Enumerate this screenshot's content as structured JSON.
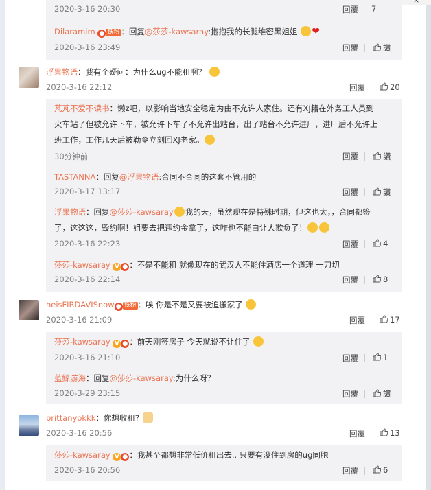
{
  "actions": {
    "reply": "回覆",
    "like_zero": "讚"
  },
  "c0": {
    "time": "2020-3-16 20:30"
  },
  "c1": {
    "name": "Dilaramim",
    "badge": "铁粉",
    "prefix": "：回复",
    "at": "@莎莎-kawsaray",
    "text": ":抱抱我的长腿维密黑姐姐",
    "time": "2020-3-16 23:49"
  },
  "c2": {
    "name": "浮果物语",
    "text": "：我有个疑问：为什么ug不能租啊？",
    "time": "2020-3-16 22:12",
    "likes": "20"
  },
  "c2r1": {
    "name": "芃芃不爱不读书",
    "line1": "：懒z吧，以影响当地安全稳定为由不允许人家住。还有XJ籍在外务工人员到",
    "line2": "火车站了但被允许下车，被允许下车了不允许出站台，出了站台不允许进厂，进厂后不允许上",
    "line3": "班工作，工作几天后被勒令立刻回XJ老家。",
    "time": "30分钟前"
  },
  "c2r2": {
    "name": "TASTANNA",
    "prefix": "：回复",
    "at": "@浮果物语",
    "text": ":合同不合同的这套不管用的",
    "time": "2020-3-17 13:17"
  },
  "c2r3": {
    "name": "浮果物语",
    "prefix": "：回复",
    "at": "@莎莎-kawsaray",
    "text1": "我的天，虽然现在是特殊时期，但这也太，，合同都签",
    "line2": "了，这这这，毁约啊！姐要去把违约金拿了，这咋也不能白让人欺负了！",
    "time": "2020-3-16 22:23",
    "likes": "4"
  },
  "c2r4": {
    "name": "莎莎-kawsaray",
    "text": "：不是不能租 就像现在的武汉人不能住酒店一个道理 一刀切",
    "time": "2020-3-16 22:14",
    "likes": "8"
  },
  "c3": {
    "name": "heisFIRDAVISnow",
    "badge": "铁粉",
    "text": "：唉 你是不是又要被迫搬家了",
    "time": "2020-3-16 21:09",
    "likes": "17"
  },
  "c3r1": {
    "name": "莎莎-kawsaray",
    "text": "：前天刚签房子 今天就说不让住了",
    "time": "2020-3-16 21:10",
    "likes": "1"
  },
  "c3r2": {
    "name": "蓝鲸游海",
    "prefix": "：回复",
    "at": "@莎莎-kawsaray",
    "text": ":为什么呀？",
    "time": "2020-3-29 23:15"
  },
  "c4": {
    "name": "brittanyokkk",
    "text": "：你想收租?",
    "time": "2020-3-16 20:56",
    "likes": "13"
  },
  "c4r1": {
    "name": "莎莎-kawsaray",
    "text": "：我甚至都想非常低价租出去.. 只要有没住到房的ug同胞",
    "time": "2020-3-16 20:56",
    "likes": "6"
  },
  "colors": {
    "accent": "#eb7350",
    "blue": "#1e90ff"
  }
}
